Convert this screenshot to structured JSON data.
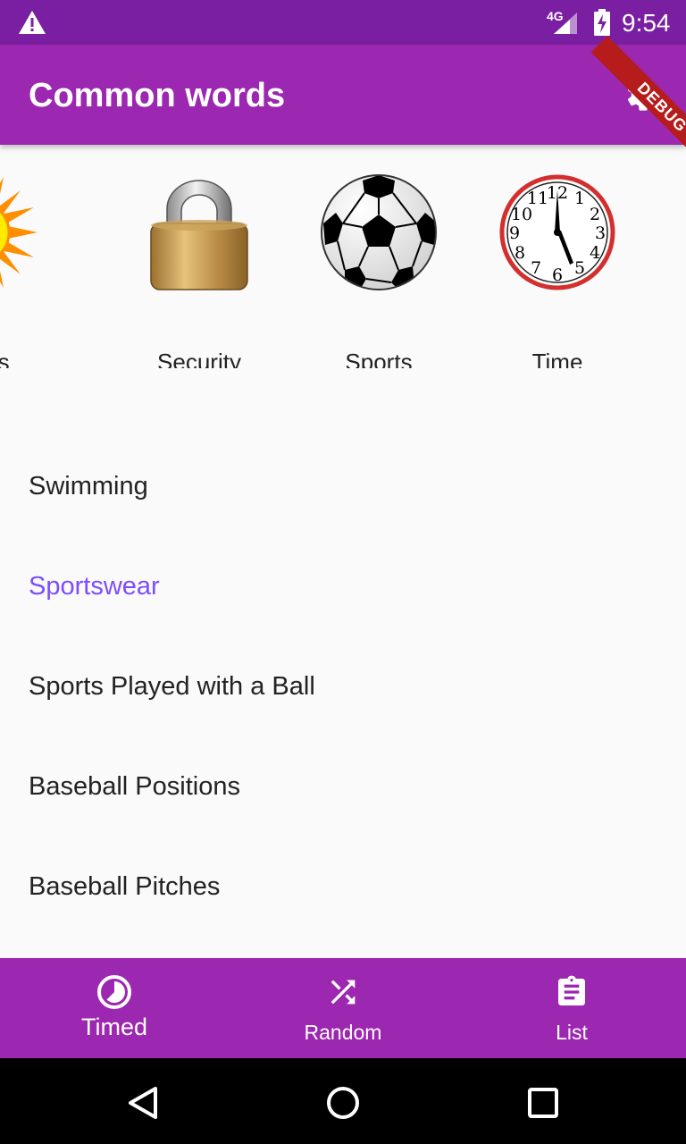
{
  "status_bar": {
    "network": "4G",
    "time": "9:54",
    "icons": [
      "warning-icon",
      "signal-icon",
      "battery-charging-icon"
    ]
  },
  "debug_banner": "DEBUG",
  "app_bar": {
    "title": "Common words",
    "settings_icon": "gear-icon"
  },
  "categories": [
    {
      "label": "Seasons",
      "shown_label": "asons",
      "icon": "sun-icon"
    },
    {
      "label": "Security",
      "icon": "padlock-icon"
    },
    {
      "label": "Sports",
      "icon": "soccer-ball-icon"
    },
    {
      "label": "Time",
      "icon": "clock-icon"
    }
  ],
  "list": {
    "items": [
      {
        "label": "Swimming",
        "active": false
      },
      {
        "label": "Sportswear",
        "active": true
      },
      {
        "label": "Sports Played with a Ball",
        "active": false
      },
      {
        "label": "Baseball Positions",
        "active": false
      },
      {
        "label": "Baseball Pitches",
        "active": false
      }
    ],
    "accent_color": "#7c4dff"
  },
  "bottom_nav": {
    "items": [
      {
        "label": "Timed",
        "icon": "timer-icon",
        "selected": true
      },
      {
        "label": "Random",
        "icon": "shuffle-icon",
        "selected": false
      },
      {
        "label": "List",
        "icon": "clipboard-list-icon",
        "selected": false
      }
    ]
  },
  "colors": {
    "primary": "#9c27b0",
    "primary_dark": "#7b1fa2",
    "background": "#fafafa",
    "text": "#222222"
  }
}
